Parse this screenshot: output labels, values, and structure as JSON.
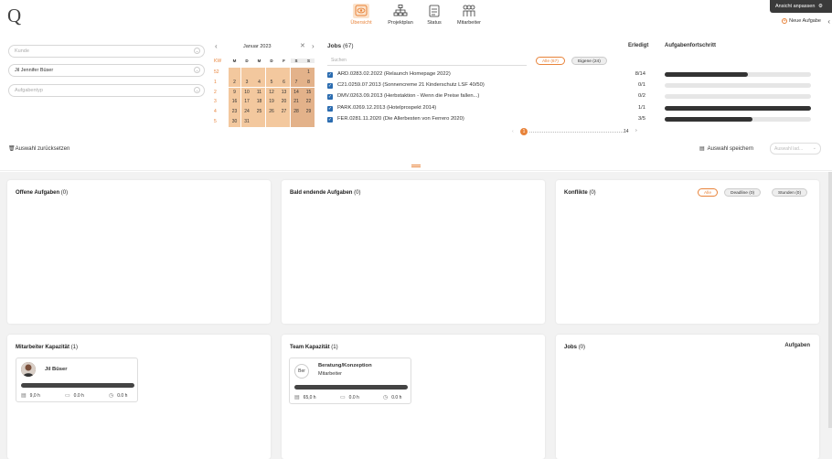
{
  "app": {
    "logo": "Q"
  },
  "nav": [
    {
      "label": "Übersicht",
      "active": true
    },
    {
      "label": "Projektplan",
      "active": false
    },
    {
      "label": "Status",
      "active": false
    },
    {
      "label": "Mitarbeiter",
      "active": false
    }
  ],
  "top_right": {
    "customize_label": "Ansicht anpassen",
    "new_task_label": "Neue Aufgabe"
  },
  "filters": {
    "kunde_placeholder": "Kunde",
    "person_value": "Jil Jennifer Büser",
    "aufgabentyp_placeholder": "Aufgabentyp",
    "reset_label": "Auswahl zurücksetzen"
  },
  "calendar": {
    "month_label": "Januar 2023",
    "kw_header": "KW",
    "day_headers": [
      "M",
      "D",
      "M",
      "D",
      "F",
      "S",
      "S"
    ],
    "weeks": [
      {
        "kw": "52",
        "days": [
          "",
          "",
          "",
          "",
          "",
          "",
          "1"
        ]
      },
      {
        "kw": "1",
        "days": [
          "2",
          "3",
          "4",
          "5",
          "6",
          "7",
          "8"
        ]
      },
      {
        "kw": "2",
        "days": [
          "9",
          "10",
          "11",
          "12",
          "13",
          "14",
          "15"
        ]
      },
      {
        "kw": "3",
        "days": [
          "16",
          "17",
          "18",
          "19",
          "20",
          "21",
          "22"
        ]
      },
      {
        "kw": "4",
        "days": [
          "23",
          "24",
          "25",
          "26",
          "27",
          "28",
          "29"
        ]
      },
      {
        "kw": "5",
        "days": [
          "30",
          "31",
          "",
          "",
          "",
          "",
          ""
        ]
      }
    ]
  },
  "jobs": {
    "title": "Jobs",
    "count": "(67)",
    "search_placeholder": "Suchen",
    "filter_all": "Alle (67)",
    "filter_own": "Eigene (24)",
    "col_done": "Erledigt",
    "col_progress": "Aufgabenfortschritt",
    "rows": [
      {
        "label": "ARD.0283.02.2022 (Relaunch Homepage 2022)",
        "done": "8/14",
        "progress": 0.57
      },
      {
        "label": "C21.0259.07.2013 (Sonnencreme 21 Kinderschutz LSF 40/50)",
        "done": "0/1",
        "progress": 0
      },
      {
        "label": "DMV.0263.09.2013 (Herbstaktion - Wenn die Preise fallen...)",
        "done": "0/2",
        "progress": 0
      },
      {
        "label": "PARK.0269.12.2013 (Hotelprospekt 2014)",
        "done": "1/1",
        "progress": 1.0
      },
      {
        "label": "FER.0281.11.2020 (Die Allerbesten von Ferrero 2020)",
        "done": "3/5",
        "progress": 0.6
      }
    ],
    "page_current": "1",
    "page_last": "14"
  },
  "selection": {
    "save_label": "Auswahl speichern",
    "load_placeholder": "Auswahl lad..."
  },
  "panels": {
    "open_tasks": {
      "title": "Offene Aufgaben",
      "count": "(0)"
    },
    "ending_tasks": {
      "title": "Bald endende Aufgaben",
      "count": "(0)"
    },
    "conflicts": {
      "title": "Konflikte",
      "count": "(0)",
      "filter_all": "Alle",
      "filter_deadline": "Deadline (0)",
      "filter_hours": "Stunden (0)"
    },
    "employee_capacity": {
      "title": "Mitarbeiter Kapazität",
      "count": "(1)",
      "name": "Jil Büser",
      "hours_planned": "9,0 h",
      "hours_calendar": "0.0 h",
      "hours_time": "0.0 h"
    },
    "team_capacity": {
      "title": "Team Kapazität",
      "count": "(1)",
      "initials": "Ber",
      "team_name": "Beratung/Konzeption",
      "team_role": "Mitarbeiter",
      "hours_planned": "65,0 h",
      "hours_calendar": "0.0 h",
      "hours_time": "0.0 h"
    },
    "jobs_panel": {
      "title": "Jobs",
      "count": "(0)",
      "right_label": "Aufgaben"
    }
  },
  "colors": {
    "accent": "#e8833a",
    "calendar_fill": "#f3c89e",
    "weekend_fill": "#e3b28a"
  }
}
